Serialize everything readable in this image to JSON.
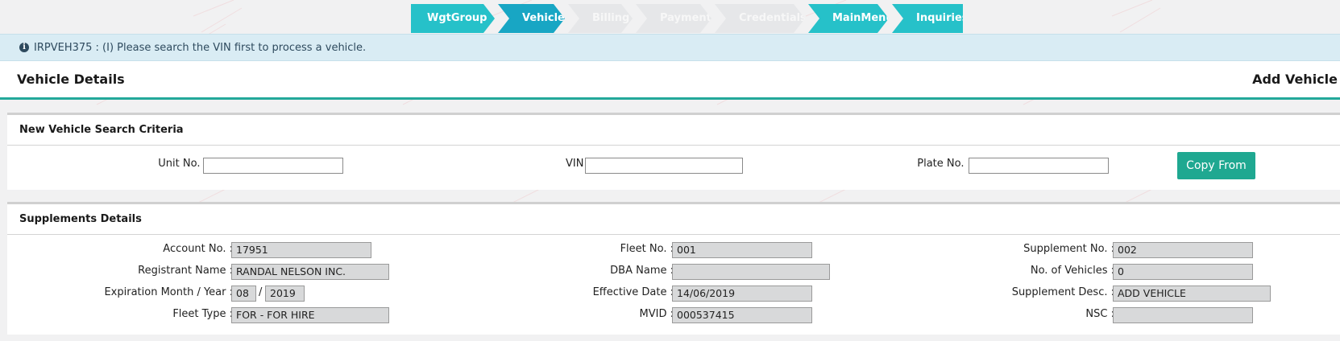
{
  "steps": [
    {
      "label": "WgtGroup",
      "state": "done"
    },
    {
      "label": "Vehicle",
      "state": "current"
    },
    {
      "label": "Billing",
      "state": "disabled"
    },
    {
      "label": "Payment",
      "state": "disabled"
    },
    {
      "label": "Credentials",
      "state": "disabled"
    },
    {
      "label": "MainMenu",
      "state": "done"
    },
    {
      "label": "Inquiries",
      "state": "done"
    }
  ],
  "info": {
    "icon": "info-icon",
    "message": "IRPVEH375 : (I) Please search the VIN first to process a vehicle."
  },
  "header": {
    "title": "Vehicle Details",
    "action": "Add Vehicle"
  },
  "search": {
    "heading": "New Vehicle Search Criteria",
    "unit_label": "Unit No. :",
    "unit_value": "",
    "vin_label": "VIN :",
    "vin_value": "",
    "plate_label": "Plate No. :",
    "plate_value": "",
    "copy_button": "Copy From"
  },
  "supplements": {
    "heading": "Supplements Details",
    "account_label": "Account No. :",
    "account_value": "17951",
    "registrant_label": "Registrant Name :",
    "registrant_value": "RANDAL NELSON INC.",
    "expiration_label": "Expiration Month / Year :",
    "expiration_month": "08",
    "expiration_sep": "/",
    "expiration_year": "2019",
    "fleet_type_label": "Fleet Type :",
    "fleet_type_value": "FOR - FOR HIRE",
    "fleet_no_label": "Fleet No. :",
    "fleet_no_value": "001",
    "dba_label": "DBA Name :",
    "dba_value": "",
    "effective_label": "Effective Date :",
    "effective_value": "14/06/2019",
    "mvid_label": "MVID :",
    "mvid_value": "000537415",
    "supp_no_label": "Supplement No. :",
    "supp_no_value": "002",
    "num_vehicles_label": "No. of Vehicles :",
    "num_vehicles_value": "0",
    "supp_desc_label": "Supplement Desc. :",
    "supp_desc_value": "ADD VEHICLE",
    "nsc_label": "NSC :",
    "nsc_value": ""
  },
  "colors": {
    "step_done": "#26c1c9",
    "step_current": "#18a6c4",
    "step_disabled": "#e6e7e9",
    "accent": "#23a89a",
    "button": "#1fa891",
    "info_bg": "#d9ecf4"
  }
}
